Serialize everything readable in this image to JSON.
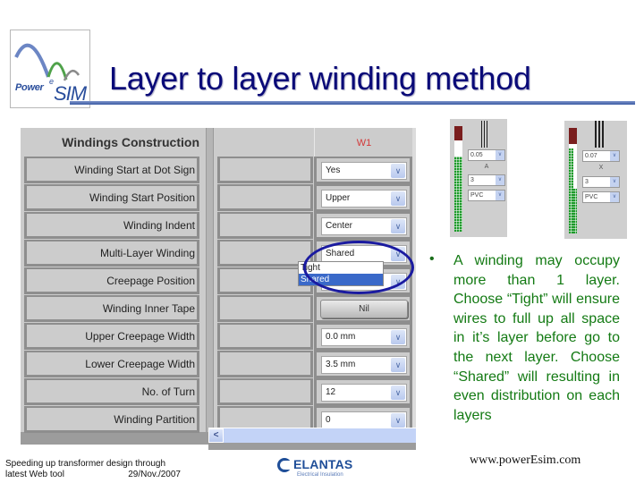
{
  "slide": {
    "title": "Layer to layer winding method",
    "logo": {
      "brand": "Power",
      "superscript": "e",
      "product": "SIM"
    }
  },
  "panel": {
    "header": "Windings Construction",
    "column_label": "W1",
    "rows": [
      {
        "label": "Winding Start at Dot Sign",
        "control": "select",
        "value": "Yes"
      },
      {
        "label": "Winding Start Position",
        "control": "select",
        "value": "Upper"
      },
      {
        "label": "Winding Indent",
        "control": "select",
        "value": "Center"
      },
      {
        "label": "Multi-Layer Winding",
        "control": "select",
        "value": "Shared"
      },
      {
        "label": "Creepage Position",
        "control": "select",
        "value": ""
      },
      {
        "label": "Winding Inner Tape",
        "control": "button",
        "value": "Nil"
      },
      {
        "label": "Upper Creepage Width",
        "control": "select",
        "value": "0.0 mm"
      },
      {
        "label": "Lower Creepage Width",
        "control": "select",
        "value": "3.5 mm"
      },
      {
        "label": "No. of Turn",
        "control": "select",
        "value": "12"
      },
      {
        "label": "Winding Partition",
        "control": "select",
        "value": "0"
      }
    ],
    "open_dropdown": {
      "options": [
        "Tight",
        "Shared"
      ],
      "highlighted": "Shared"
    },
    "dropdown_arrow_glyph": "∨",
    "scroll_left_glyph": "<"
  },
  "mini_screens": [
    {
      "wire_size": "0.05",
      "separator": "A",
      "count": "3",
      "insulation": "PVC",
      "fill_fraction": 0.68,
      "variant": "shared"
    },
    {
      "wire_size": "0.07",
      "separator": "X",
      "count": "3",
      "insulation": "PVC",
      "fill_fraction": 0.88,
      "variant": "tight"
    }
  ],
  "bullet": {
    "marker": "•",
    "text": "A winding may occupy more than 1 layer. Choose “Tight” will ensure wires to full up all space in it’s layer before go to the next layer. Choose “Shared” will resulting in even distribution on each layers"
  },
  "footer": {
    "line1": "Speeding up transformer design through",
    "line2_left": "latest Web tool",
    "date": "29/Nov./2007",
    "partner_name": "ELANTAS",
    "partner_tagline": "Electrical Insulation",
    "website": "www.powerEsim.com"
  },
  "colors": {
    "title": "#0a0a78",
    "bullet_text": "#137a13",
    "column_label": "#d33a3a",
    "highlight_ring": "#1a1aa0",
    "selected_option": "#3a69c9"
  }
}
